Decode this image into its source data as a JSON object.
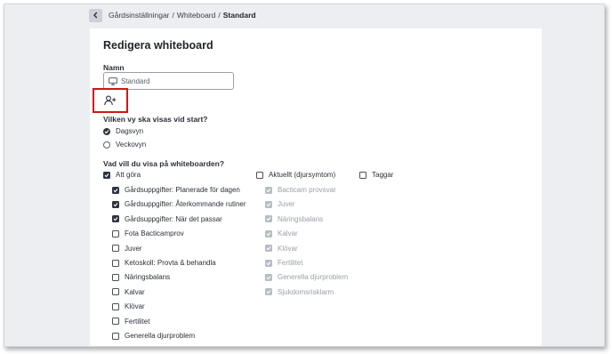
{
  "breadcrumb": {
    "items": [
      "Gårdsinställningar",
      "Whiteboard"
    ],
    "separator": "/",
    "current": "Standard"
  },
  "form": {
    "title": "Redigera whiteboard",
    "name_label": "Namn",
    "name_value": "Standard",
    "start_question": "Vilken vy ska visas vid start?",
    "start_options": [
      {
        "label": "Dagsvyn",
        "selected": true
      },
      {
        "label": "Veckovyn",
        "selected": false
      }
    ],
    "show_question": "Vad vill du visa på whiteboarden?",
    "col1": {
      "label": "Att göra",
      "checked": true,
      "items": [
        {
          "label": "Gårdsuppgifter: Planerade för dagen",
          "checked": true
        },
        {
          "label": "Gårdsuppgifter: Återkommande rutiner",
          "checked": true
        },
        {
          "label": "Gårdsuppgifter: När det passar",
          "checked": true
        },
        {
          "label": "Fota Bacticamprov",
          "checked": false
        },
        {
          "label": "Juver",
          "checked": false
        },
        {
          "label": "Ketoskoll: Provta & behandla",
          "checked": false
        },
        {
          "label": "Näringsbalans",
          "checked": false
        },
        {
          "label": "Kalvar",
          "checked": false
        },
        {
          "label": "Klövar",
          "checked": false
        },
        {
          "label": "Fertilitet",
          "checked": false
        },
        {
          "label": "Generella djurproblem",
          "checked": false
        }
      ]
    },
    "col2": {
      "label": "Aktuellt (djursymtom)",
      "checked": false,
      "items": [
        {
          "label": "Bacticam provsvar"
        },
        {
          "label": "Juver"
        },
        {
          "label": "Näringsbalans"
        },
        {
          "label": "Kalvar"
        },
        {
          "label": "Klövar"
        },
        {
          "label": "Fertilitet"
        },
        {
          "label": "Generella djurproblem"
        },
        {
          "label": "Sjukdomsrisklarm"
        }
      ]
    },
    "col3": {
      "label": "Taggar",
      "checked": false
    }
  },
  "icons": {
    "back": "chevron-left-icon",
    "name_field": "monitor-icon",
    "add_user": "add-user-icon",
    "check": "checkmark-icon"
  },
  "colors": {
    "highlight_box": "#d0161b",
    "checked_fill": "#2e3540",
    "disabled_fill": "#b8bdc4",
    "background": "#eceef1"
  }
}
